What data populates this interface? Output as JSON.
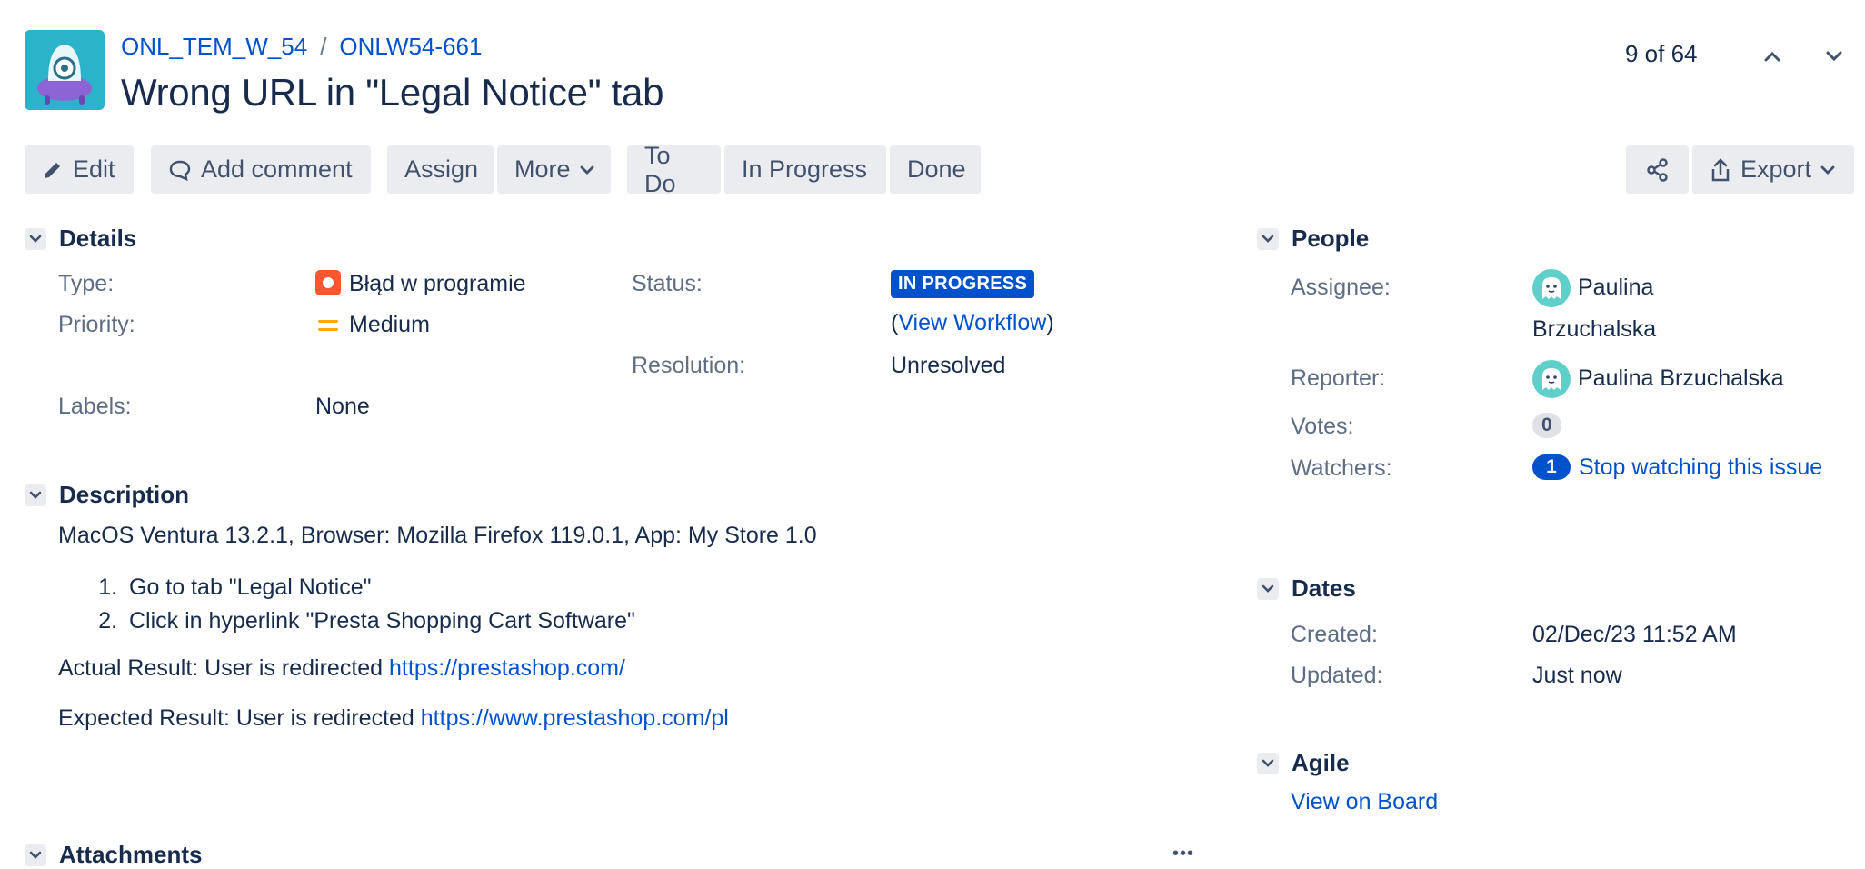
{
  "header": {
    "project_key": "ONL_TEM_W_54",
    "breadcrumb_sep": "/",
    "issue_key": "ONLW54-661",
    "title": "Wrong URL in \"Legal Notice\" tab",
    "pager": "9 of 64"
  },
  "toolbar": {
    "edit": "Edit",
    "add_comment": "Add comment",
    "assign": "Assign",
    "more": "More",
    "to_do": "To Do",
    "in_progress": "In Progress",
    "done": "Done",
    "export": "Export"
  },
  "details": {
    "heading": "Details",
    "type_label": "Type:",
    "type_value": "Błąd w programie",
    "priority_label": "Priority:",
    "priority_value": "Medium",
    "labels_label": "Labels:",
    "labels_value": "None",
    "status_label": "Status:",
    "status_value": "IN PROGRESS",
    "workflow_open": "(",
    "workflow_link": "View Workflow",
    "workflow_close": ")",
    "resolution_label": "Resolution:",
    "resolution_value": "Unresolved"
  },
  "description": {
    "heading": "Description",
    "env": "MacOS Ventura 13.2.1, Browser: Mozilla Firefox 119.0.1, App: My Store 1.0",
    "steps": [
      "Go to tab \"Legal Notice\"",
      "Click in hyperlink \"Presta Shopping Cart Software\""
    ],
    "actual_prefix": "Actual Result: User is redirected ",
    "actual_link": "https://prestashop.com/",
    "expected_prefix": "Expected Result: User is redirected ",
    "expected_link": "https://www.prestashop.com/pl"
  },
  "attachments": {
    "heading": "Attachments",
    "more": "•••"
  },
  "people": {
    "heading": "People",
    "assignee_label": "Assignee:",
    "assignee_line1": "Paulina",
    "assignee_line2": "Brzuchalska",
    "reporter_label": "Reporter:",
    "reporter_value": "Paulina Brzuchalska",
    "votes_label": "Votes:",
    "votes_value": "0",
    "watchers_label": "Watchers:",
    "watchers_count": "1",
    "watchers_link": "Stop watching this issue"
  },
  "dates": {
    "heading": "Dates",
    "created_label": "Created:",
    "created_value": "02/Dec/23 11:52 AM",
    "updated_label": "Updated:",
    "updated_value": "Just now"
  },
  "agile": {
    "heading": "Agile",
    "board_link": "View on Board"
  },
  "colors": {
    "accent": "#0052cc",
    "button_bg": "#ebecf0",
    "bug": "#ff5630",
    "priority_medium": "#ffab00"
  }
}
